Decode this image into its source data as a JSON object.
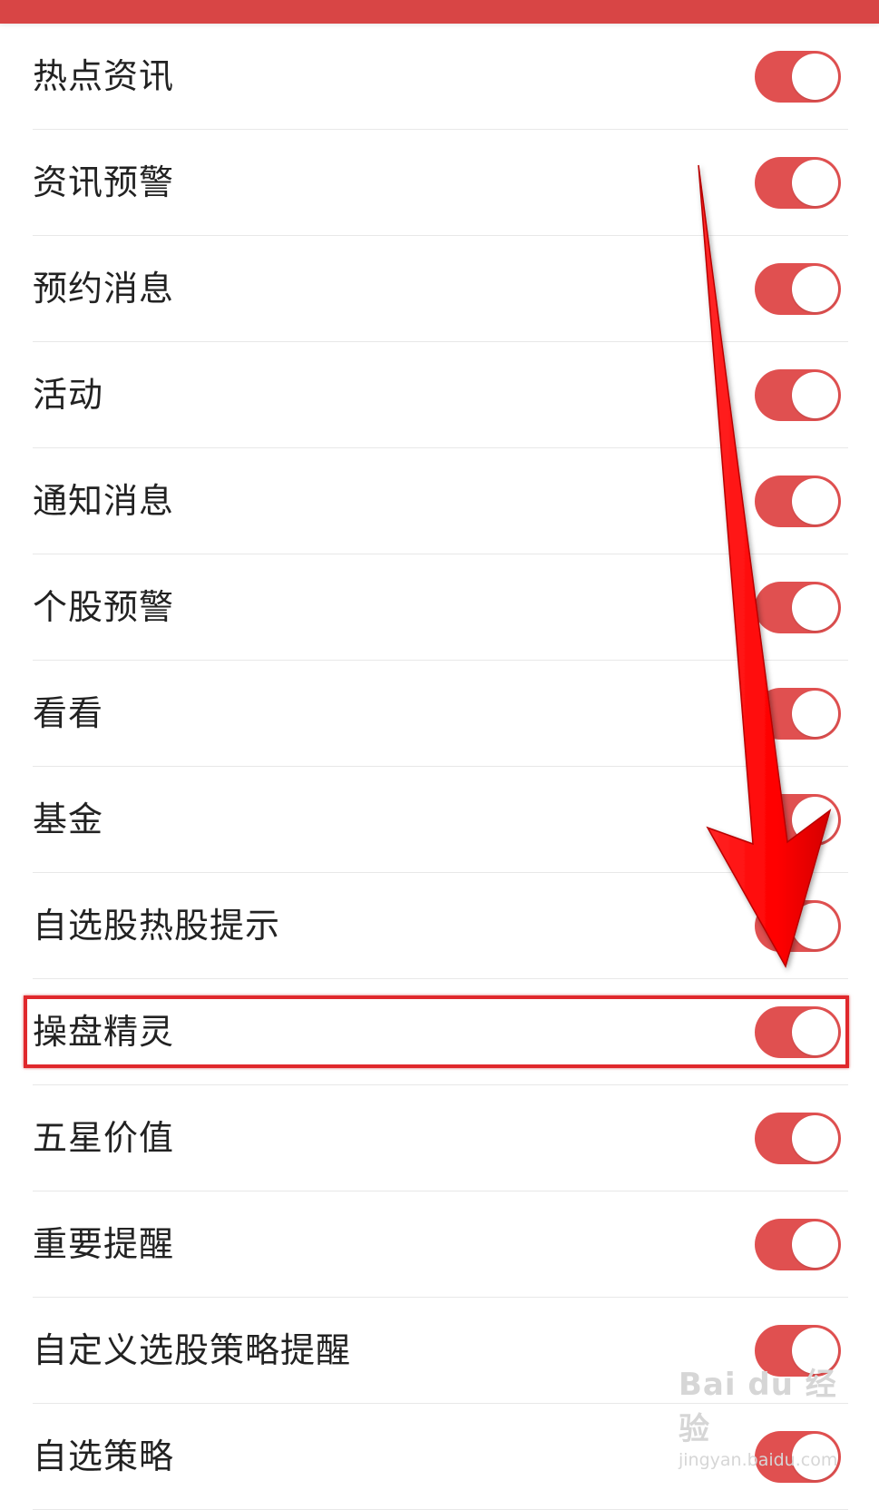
{
  "colors": {
    "accent": "#e05050",
    "topbar": "#d84545",
    "highlight": "#e0282c",
    "arrow": "#ff0000"
  },
  "settings": [
    {
      "label": "热点资讯",
      "enabled": true
    },
    {
      "label": "资讯预警",
      "enabled": true
    },
    {
      "label": "预约消息",
      "enabled": true
    },
    {
      "label": "活动",
      "enabled": true
    },
    {
      "label": "通知消息",
      "enabled": true
    },
    {
      "label": "个股预警",
      "enabled": true
    },
    {
      "label": "看看",
      "enabled": true
    },
    {
      "label": "基金",
      "enabled": true
    },
    {
      "label": "自选股热股提示",
      "enabled": true
    },
    {
      "label": "操盘精灵",
      "enabled": true
    },
    {
      "label": "五星价值",
      "enabled": true
    },
    {
      "label": "重要提醒",
      "enabled": true
    },
    {
      "label": "自定义选股策略提醒",
      "enabled": true
    },
    {
      "label": "自选策略",
      "enabled": true
    }
  ],
  "annotation": {
    "highlighted_item": "操盘精灵",
    "arrow_icon": "red-arrow-down-icon"
  },
  "watermark": {
    "brand": "Bai du 经验",
    "site": "jingyan.baidu.com"
  }
}
